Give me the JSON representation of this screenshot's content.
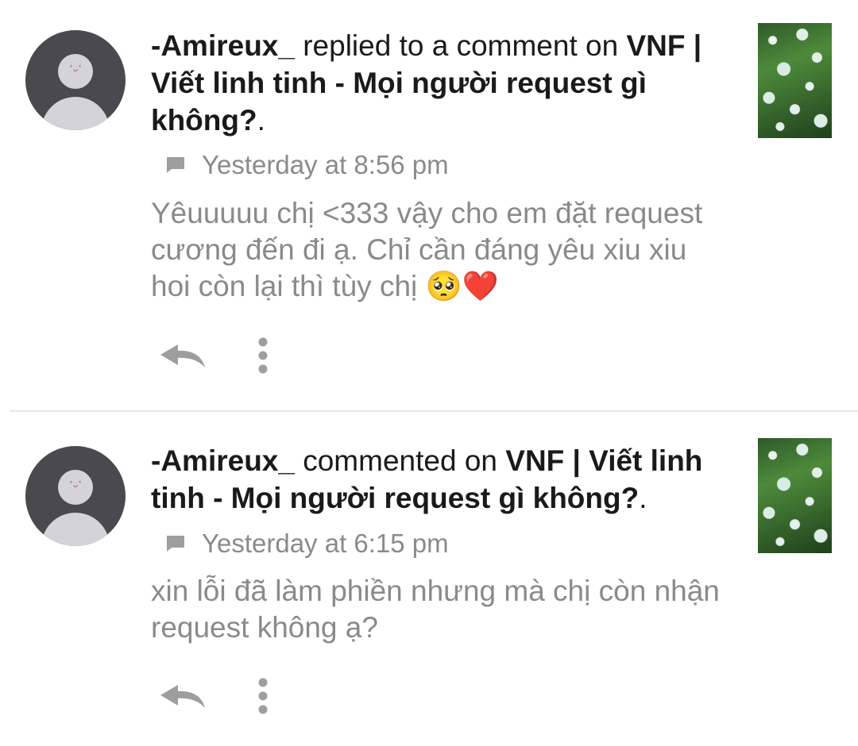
{
  "notifications": [
    {
      "actor": "-Amireux_",
      "action": " replied to a comment on ",
      "target": "VNF | Viết linh tinh - Mọi người request gì không?",
      "suffix": ".",
      "avatar_face": "˃ᴗ˂",
      "time": "Yesterday at 8:56 pm",
      "text": "Yêuuuuu chị <333 vậy cho em đặt request cương đến đi ạ. Chỉ cần đáng yêu xiu xiu hoi còn lại thì tùy chị 🥺❤️",
      "icons": [
        "comment-icon",
        "reply-icon",
        "more-vertical-icon"
      ]
    },
    {
      "actor": "-Amireux_",
      "action": " commented on ",
      "target": "VNF | Viết linh tinh - Mọi người request gì không?",
      "suffix": ".",
      "avatar_face": "˃ᴗ˂",
      "time": "Yesterday at 6:15 pm",
      "text": "xin lỗi đã làm phiền nhưng mà chị còn nhận request không ạ?",
      "icons": [
        "comment-icon",
        "reply-icon",
        "more-vertical-icon"
      ]
    }
  ],
  "colors": {
    "primary_text": "#1a1a1a",
    "secondary_text": "#8a8a8a",
    "icon_gray": "#9e9e9e",
    "avatar_bg": "#4a494e",
    "avatar_fg": "#d4d3d8",
    "divider": "#e6e6e6"
  }
}
